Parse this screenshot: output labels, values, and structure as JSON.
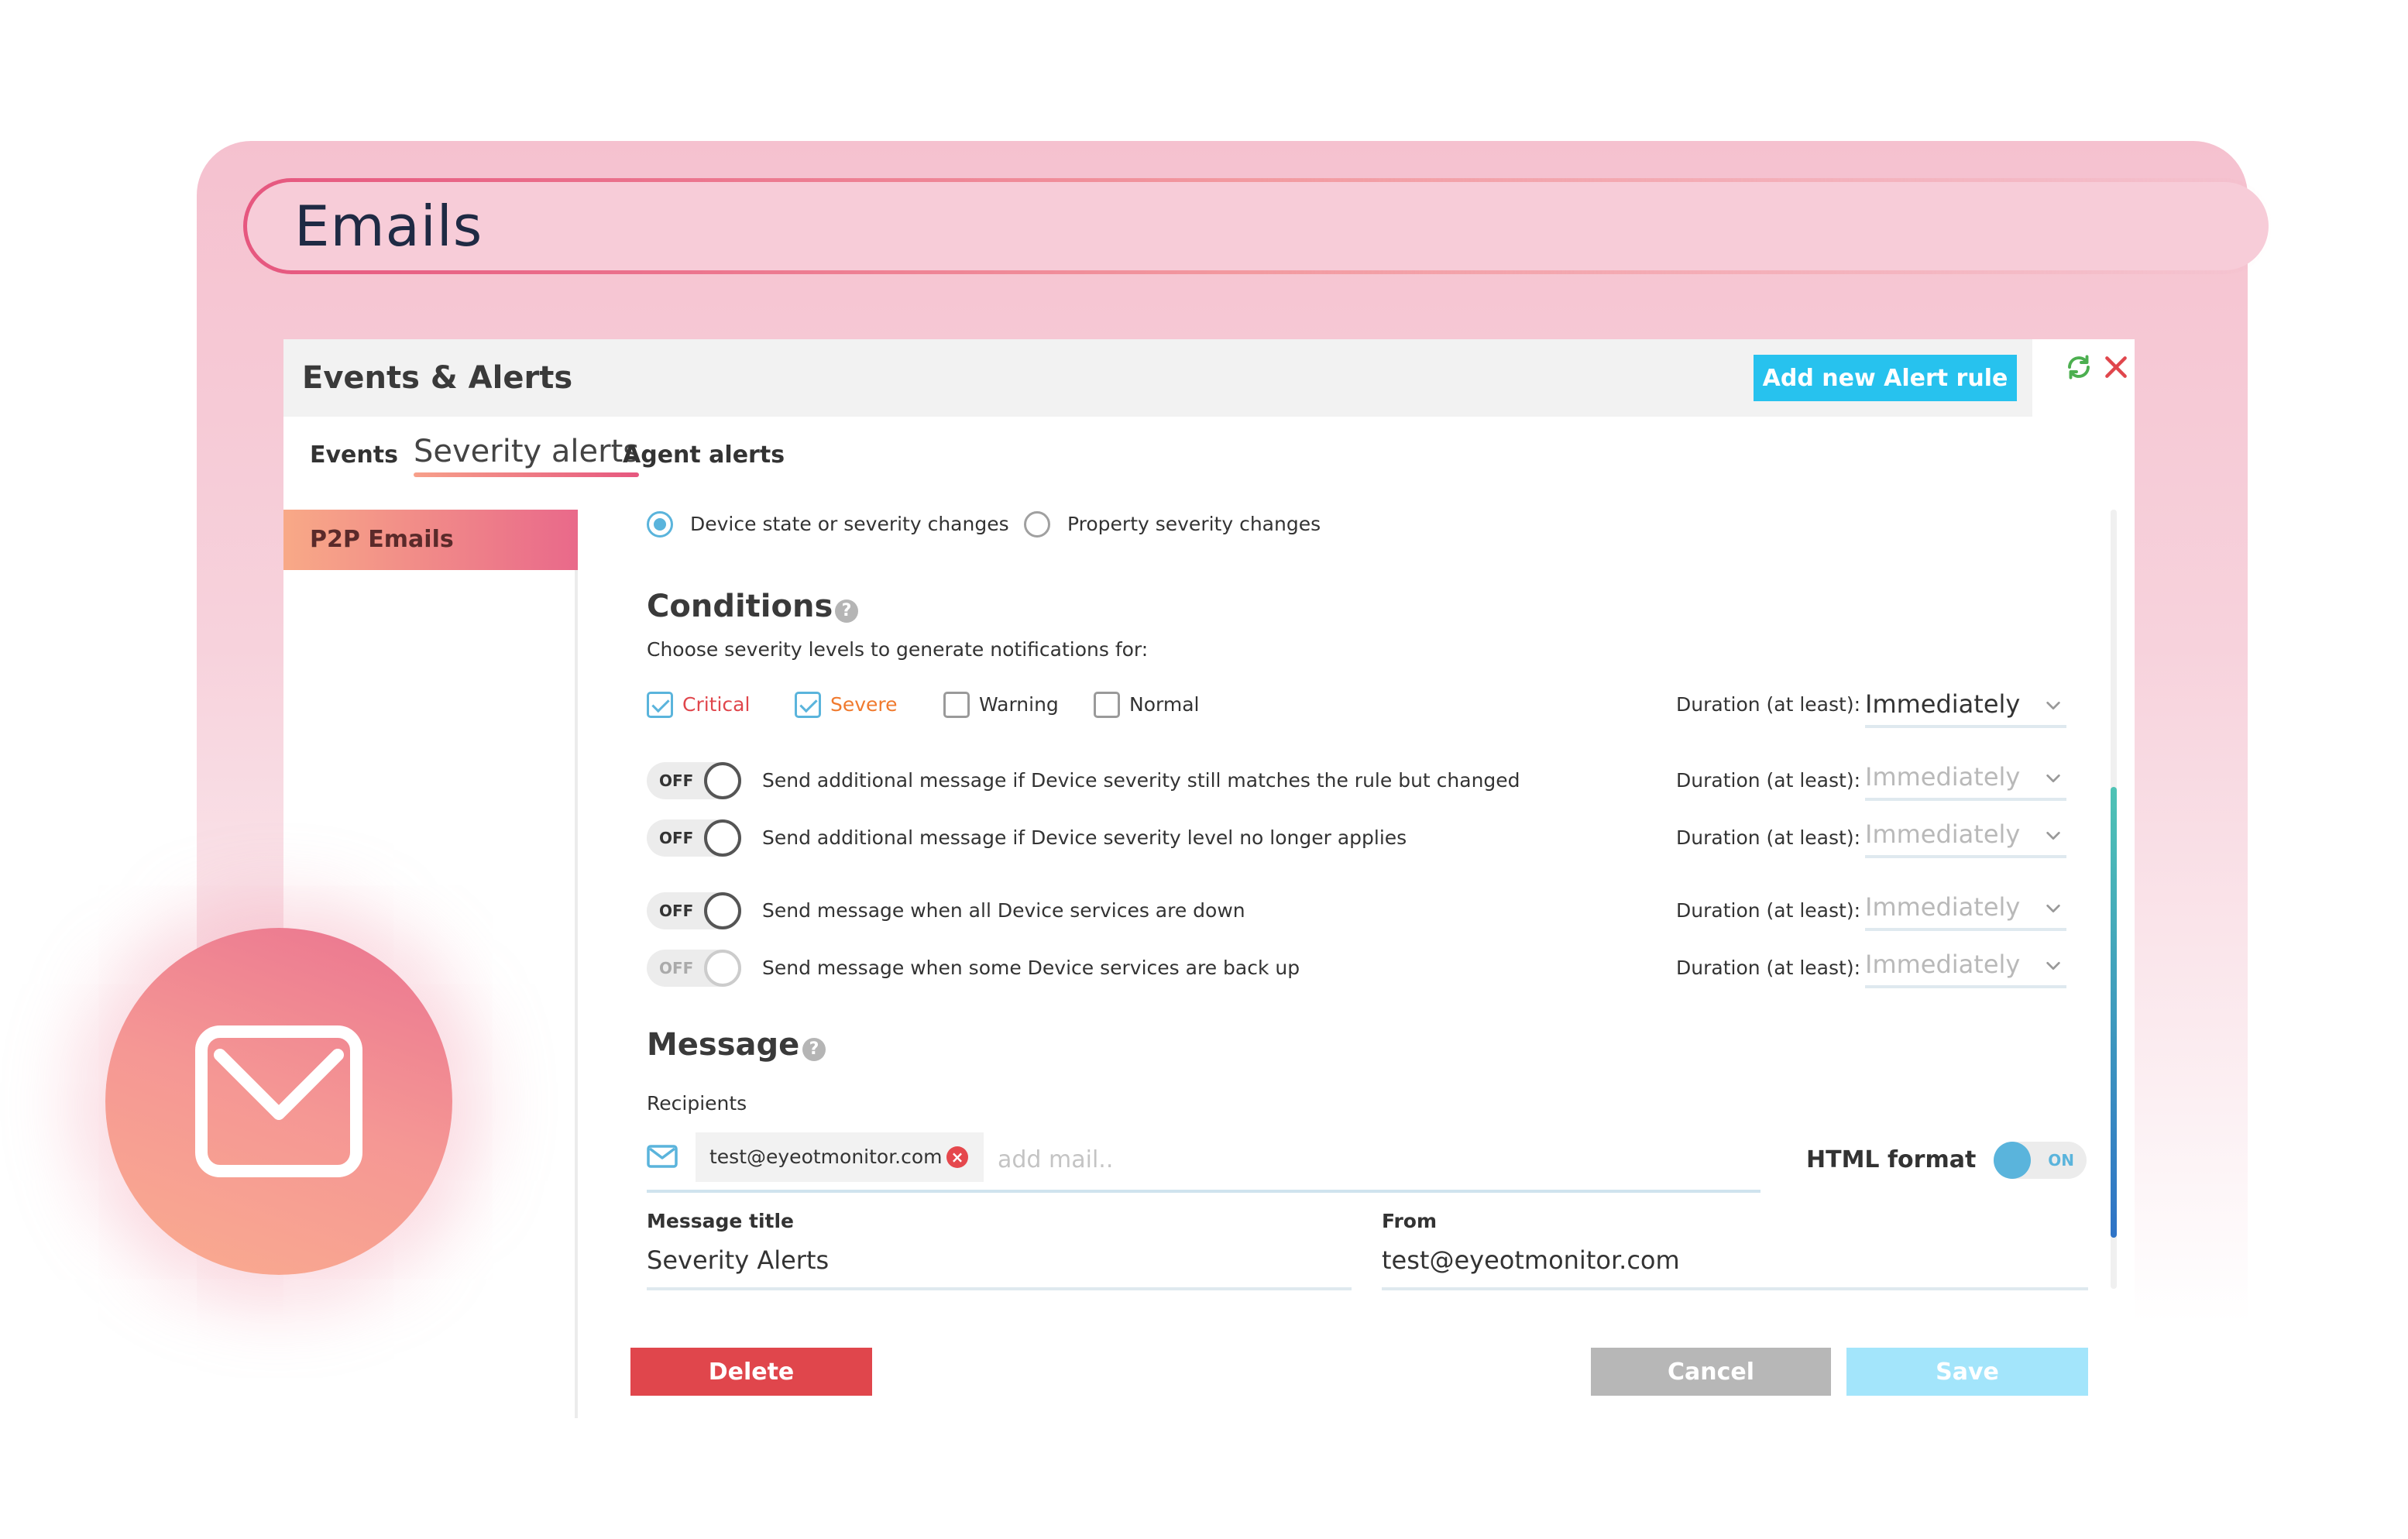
{
  "page": {
    "title": "Emails"
  },
  "panel": {
    "title": "Events & Alerts",
    "add_button": "Add new Alert rule",
    "tabs": [
      {
        "label": "Events"
      },
      {
        "label": "Severity alerts",
        "active": true
      },
      {
        "label": "Agent alerts"
      }
    ],
    "sidebar": {
      "items": [
        {
          "label": "P2P Emails",
          "active": true
        }
      ]
    }
  },
  "trigger": {
    "options": [
      {
        "label": "Device state or severity changes",
        "selected": true
      },
      {
        "label": "Property severity changes",
        "selected": false
      }
    ]
  },
  "conditions": {
    "title": "Conditions",
    "help": "?",
    "subtitle": "Choose severity levels to generate notifications for:",
    "levels": [
      {
        "label": "Critical",
        "checked": true,
        "color": "#e0464c"
      },
      {
        "label": "Severe",
        "checked": true,
        "color": "#f07a2e"
      },
      {
        "label": "Warning",
        "checked": false,
        "color": "#333333"
      },
      {
        "label": "Normal",
        "checked": false,
        "color": "#333333"
      }
    ],
    "duration_label": "Duration (at least):",
    "duration_value": "Immediately",
    "rules": [
      {
        "toggle": "OFF",
        "label": "Send additional message if Device severity still matches the rule but changed",
        "duration_label": "Duration (at least):",
        "duration_value": "Immediately",
        "enabled": false
      },
      {
        "toggle": "OFF",
        "label": "Send additional message if Device severity level no longer applies",
        "duration_label": "Duration (at least):",
        "duration_value": "Immediately",
        "enabled": false
      },
      {
        "toggle": "OFF",
        "label": "Send message when all Device services are down",
        "duration_label": "Duration (at least):",
        "duration_value": "Immediately",
        "enabled": false
      },
      {
        "toggle": "OFF",
        "label": "Send message when some Device services are back up",
        "duration_label": "Duration (at least):",
        "duration_value": "Immediately",
        "enabled": false
      }
    ]
  },
  "message": {
    "title": "Message",
    "help": "?",
    "recipients_label": "Recipients",
    "recipients": [
      "test@eyeotmonitor.com"
    ],
    "remove_glyph": "×",
    "add_placeholder": "add mail..",
    "html_format_label": "HTML format",
    "html_format_toggle": "ON",
    "message_title_label": "Message title",
    "message_title_value": "Severity Alerts",
    "from_label": "From",
    "from_value": "test@eyeotmonitor.com"
  },
  "actions": {
    "delete": "Delete",
    "cancel": "Cancel",
    "save": "Save"
  },
  "colors": {
    "accent": "#27c2ee",
    "radio": "#5ab4dc",
    "danger": "#e0464c",
    "muted_text": "#b9b9b9",
    "refresh": "#4caf50",
    "close": "#e0464c"
  },
  "icons": {
    "refresh": "refresh-icon",
    "close": "close-icon",
    "help": "help-icon",
    "mail": "mail-icon",
    "chevron": "chevron-down-icon",
    "badge": "envelope-icon"
  }
}
